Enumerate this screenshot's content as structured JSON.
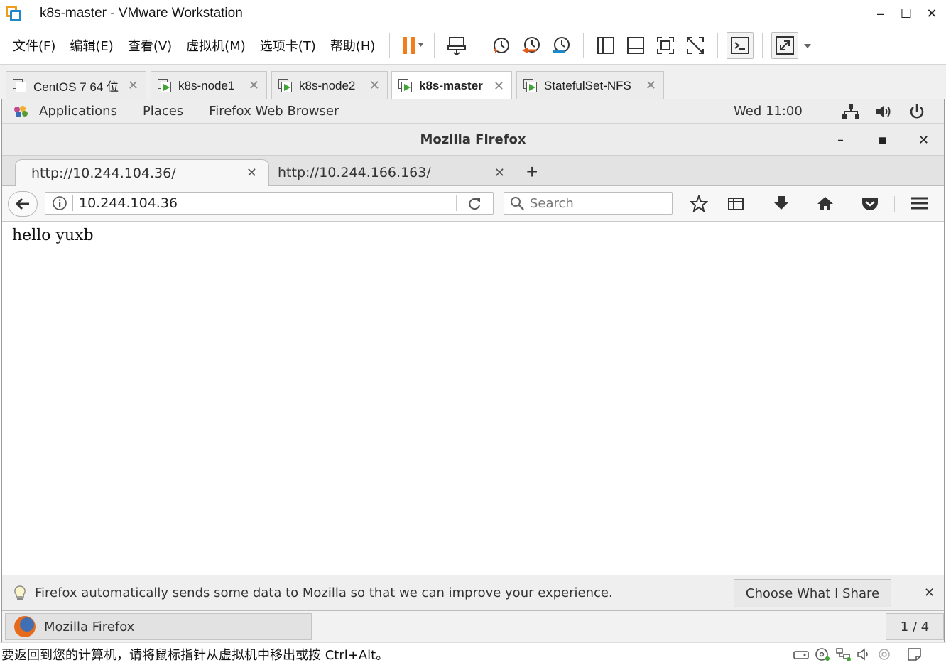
{
  "window": {
    "title": "k8s-master - VMware Workstation",
    "minimize": "–",
    "maximize": "☐",
    "close": "✕"
  },
  "menu": [
    "文件(F)",
    "编辑(E)",
    "查看(V)",
    "虚拟机(M)",
    "选项卡(T)",
    "帮助(H)"
  ],
  "vm_tabs": [
    {
      "label": "CentOS 7 64 位",
      "active": false
    },
    {
      "label": "k8s-node1",
      "active": false
    },
    {
      "label": "k8s-node2",
      "active": false
    },
    {
      "label": "k8s-master",
      "active": true
    },
    {
      "label": "StatefulSet-NFS",
      "active": false
    }
  ],
  "gnome": {
    "applications": "Applications",
    "places": "Places",
    "active_app": "Firefox Web Browser",
    "clock": "Wed 11:00"
  },
  "firefox": {
    "window_title": "Mozilla Firefox",
    "tabs": [
      {
        "label": "http://10.244.104.36/",
        "selected": true
      },
      {
        "label": "http://10.244.166.163/",
        "selected": false
      }
    ],
    "url": "10.244.104.36",
    "search_placeholder": "Search",
    "page_text": "hello yuxb",
    "notification": "Firefox automatically sends some data to Mozilla so that we can improve your experience.",
    "notification_button": "Choose What I Share"
  },
  "taskbar": {
    "item": "Mozilla Firefox",
    "workspace": "1 / 4"
  },
  "status": {
    "message": "要返回到您的计算机，请将鼠标指针从虚拟机中移出或按 Ctrl+Alt。"
  },
  "colors": {
    "pause_orange": "#f07f1b",
    "vm_play_green": "#3fa535",
    "logo_orange": "#f19a1b",
    "logo_blue": "#1e88c9"
  }
}
